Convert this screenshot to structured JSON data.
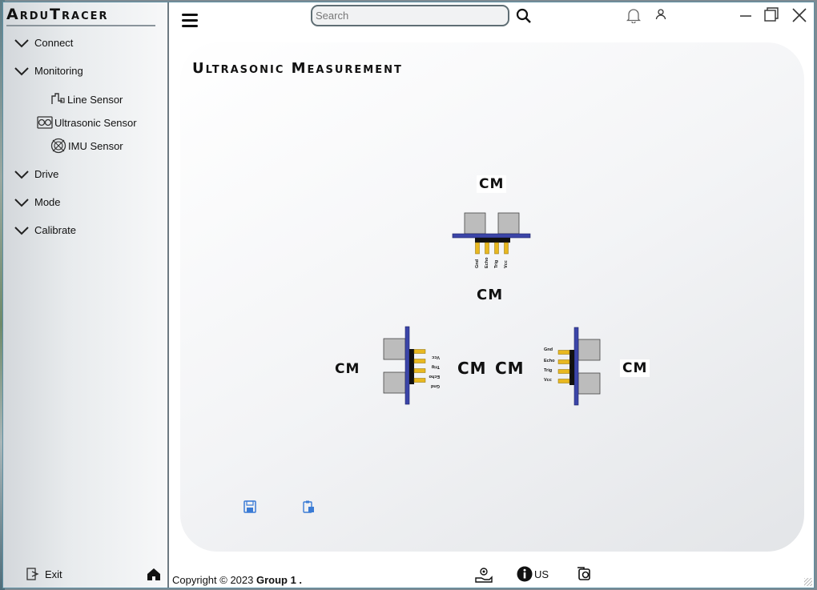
{
  "app": {
    "title": "ArduTracer"
  },
  "sidebar": {
    "items": [
      {
        "label": "Connect"
      },
      {
        "label": "Monitoring"
      },
      {
        "label": "Drive"
      },
      {
        "label": "Mode"
      },
      {
        "label": "Calibrate"
      }
    ],
    "monitoring_sub": [
      {
        "label": "Line Sensor",
        "icon": "line-sensor-icon"
      },
      {
        "label": "Ultrasonic Sensor",
        "icon": "ultrasonic-sensor-icon"
      },
      {
        "label": "IMU Sensor",
        "icon": "imu-sensor-icon"
      }
    ],
    "exit_label": "Exit"
  },
  "topbar": {
    "search_placeholder": "Search",
    "search_value": ""
  },
  "main": {
    "title": "Ultrasonic Measurement",
    "readings": {
      "top_value": "CM",
      "front_value": "CM",
      "left_value": "CM",
      "center_left_value": "CM",
      "center_right_value": "CM",
      "right_value": "CM"
    },
    "pin_labels": [
      "Gnd",
      "Echo",
      "Trig",
      "Vcc"
    ]
  },
  "footer": {
    "copyright": "Copyright © 2023 ",
    "group": "Group 1 .",
    "info_label": "US"
  },
  "colors": {
    "board": "#3b45a8",
    "pin": "#e8b820",
    "transducer": "#bcbcbc"
  }
}
